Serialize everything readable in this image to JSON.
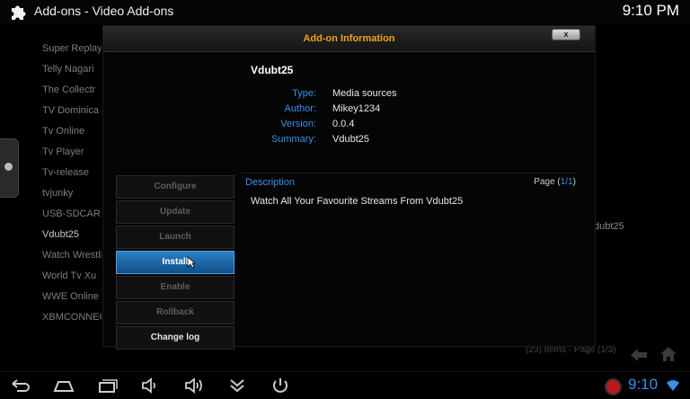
{
  "topbar": {
    "title": "Add-ons  -  Video Add-ons",
    "clock": "9:10 PM"
  },
  "background_list": {
    "items": [
      "Super Replay",
      "Telly Nagari",
      "The Collectr",
      "TV Dominica",
      "Tv Online",
      "Tv Player",
      "Tv-release",
      "tvjunky",
      "USB-SDCAR",
      "Vdubt25",
      "Watch Wrestling",
      "World Tv Xu",
      "WWE Online",
      "XBMCONNECT"
    ],
    "right_text": "dubt25",
    "footer": "(23) Items - Page (1/3)"
  },
  "dialog": {
    "title": "Add-on Information",
    "close_label": "x",
    "addon_name": "Vdubt25",
    "fields": [
      {
        "label": "Type:",
        "value": "Media sources"
      },
      {
        "label": "Author:",
        "value": "Mikey1234"
      },
      {
        "label": "Version:",
        "value": "0.0.4"
      },
      {
        "label": "Summary:",
        "value": "Vdubt25"
      }
    ],
    "buttons": [
      {
        "label": "Configure",
        "state": "disabled"
      },
      {
        "label": "Update",
        "state": "disabled"
      },
      {
        "label": "Launch",
        "state": "disabled"
      },
      {
        "label": "Install",
        "state": "focused"
      },
      {
        "label": "Enable",
        "state": "disabled"
      },
      {
        "label": "Rollback",
        "state": "disabled"
      },
      {
        "label": "Change log",
        "state": "enabled"
      }
    ],
    "description_label": "Description",
    "page_prefix": "Page (",
    "page_value": "1/1",
    "page_suffix": ")",
    "description_text": "Watch All Your Favourite Streams From Vdubt25"
  },
  "navbar": {
    "clock": "9:10"
  },
  "colors": {
    "accent": "#3a8ee8",
    "title_orange": "#f0a31c",
    "focus_blue": "#1f6db0",
    "record_red": "#c0161e"
  },
  "icons": [
    "puzzle-icon",
    "back-icon",
    "home-icon",
    "recent-apps-icon",
    "volume-down-icon",
    "volume-up-icon",
    "menu-chevrons-icon",
    "power-icon",
    "record-icon",
    "wifi-icon",
    "screenshot-icon",
    "cursor-icon"
  ]
}
